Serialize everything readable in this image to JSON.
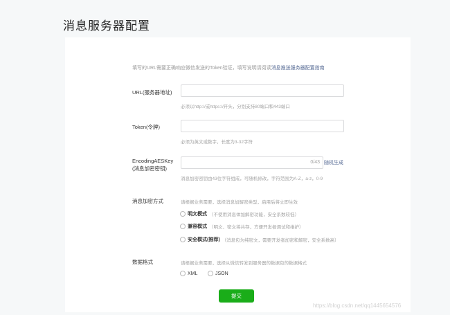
{
  "page": {
    "title": "消息服务器配置"
  },
  "intro": {
    "text": "填写的URL需要正确响应微信发送的Token验证，填写说明请阅读",
    "link": "消息推送服务器配置指南"
  },
  "fields": {
    "url": {
      "label": "URL(服务器地址)",
      "value": "",
      "hint": "必须以http://或https://开头，分别支持80端口和443端口"
    },
    "token": {
      "label": "Token(令牌)",
      "value": "",
      "hint": "必须为英文或数字，长度为3-32字符"
    },
    "aes": {
      "label_line1": "EncodingAESKey",
      "label_line2": "(消息加密密钥)",
      "value": "",
      "counter": "0/43",
      "generate": "随机生成",
      "hint": "消息加密密钥由43位字符组成，可随机修改，字符范围为A-Z，a-z，0-9"
    }
  },
  "encryption": {
    "label": "消息加密方式",
    "hint": "请根据业务需要，选择消息加解密类型，启用后将立即生效",
    "options": [
      {
        "name": "明文模式",
        "desc": "（不使用消息体加解密功能，安全系数较低）"
      },
      {
        "name": "兼容模式",
        "desc": "（明文、密文将共存，方便开发者调试和维护）"
      },
      {
        "name": "安全模式(推荐)",
        "desc": "（消息包为纯密文，需要开发者加密和解密，安全系数高）"
      }
    ]
  },
  "format": {
    "label": "数据格式",
    "hint": "请根据业务需要，选择从微信转发到服务器的数据包的数据格式",
    "options": [
      "XML",
      "JSON"
    ]
  },
  "submit": {
    "label": "提交"
  },
  "watermark": "https://blog.csdn.net/qq1445654576"
}
